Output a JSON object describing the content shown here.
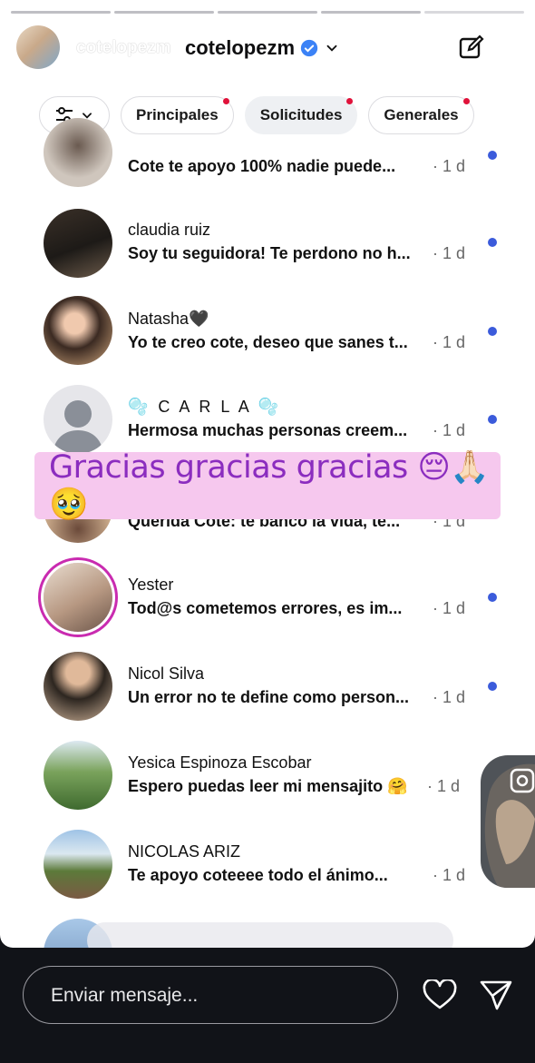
{
  "header": {
    "story_user": "cotelopezm",
    "dm_title": "cotelopezm",
    "verified_icon": "verified-badge-icon",
    "chevron_icon": "chevron-down-icon",
    "edit_icon": "edit-icon",
    "close_icon": "close-icon"
  },
  "filters": {
    "sliders_icon": "sliders-icon",
    "chips": [
      {
        "label": "Principales",
        "has_dot": true
      },
      {
        "label": "Solicitudes",
        "has_dot": true
      },
      {
        "label": "Generales",
        "has_dot": true
      }
    ]
  },
  "conversations": [
    {
      "name": "",
      "message": "Cote te apoyo 100% nadie puede...",
      "time": "· 1 d"
    },
    {
      "name": "claudia ruiz",
      "message": "Soy tu seguidora! Te perdono no h...",
      "time": "· 1 d"
    },
    {
      "name": "Natasha🖤",
      "message": "Yo te creo cote, deseo que sanes t...",
      "time": "· 1 d"
    },
    {
      "name": "🫧 C A R L A 🫧",
      "message": "Hermosa muchas personas creem...",
      "time": "· 1 d"
    },
    {
      "name": "",
      "message": "Querida Cote: te banco la vida, te...",
      "time": "· 1 d"
    },
    {
      "name": "Yester",
      "message": "Tod@s cometemos errores, es im...",
      "time": "· 1 d"
    },
    {
      "name": "Nicol Silva",
      "message": "Un error no te define como person...",
      "time": "· 1 d"
    },
    {
      "name": "Yesica Espinoza Escobar",
      "message": "Espero puedas leer mi mensajito 🤗",
      "time": "· 1 d"
    },
    {
      "name": "NICOLAS ARIZ",
      "message": "Te apoyo coteeee todo el ánimo...",
      "time": "· 1 d"
    }
  ],
  "overlay_text": "Gracias gracias gracias 😔🙏🏻🥹",
  "composer": {
    "placeholder": "Enviar mensaje...",
    "heart_icon": "heart-icon",
    "send_icon": "send-icon"
  },
  "colors": {
    "unread_dot": "#3b5bdb",
    "chip_dot": "#e0123a",
    "overlay_bg": "#f6c8ee",
    "overlay_text": "#8b2dbf",
    "story_ring": "#c92bb0"
  }
}
